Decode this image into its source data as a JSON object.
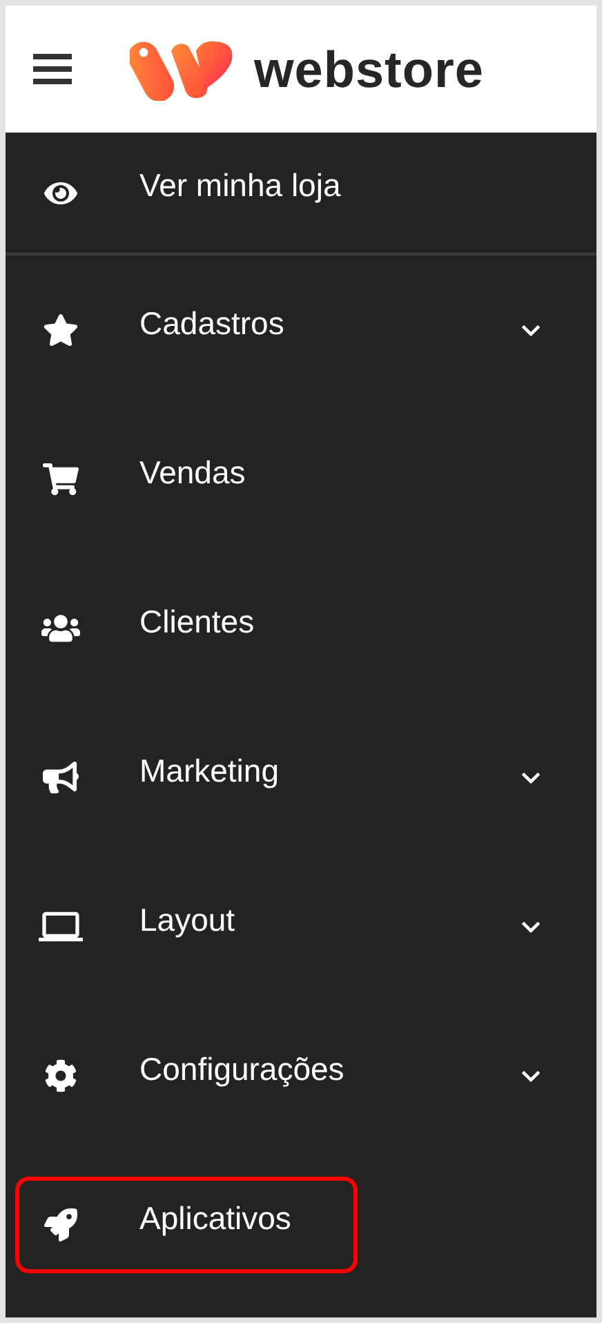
{
  "header": {
    "brand": "webstore"
  },
  "menu": [
    {
      "label": "Ver minha loja",
      "has_submenu": false,
      "highlighted": false,
      "divider_below": true
    },
    {
      "label": "Cadastros",
      "has_submenu": true,
      "highlighted": false,
      "divider_below": false
    },
    {
      "label": "Vendas",
      "has_submenu": false,
      "highlighted": false,
      "divider_below": false
    },
    {
      "label": "Clientes",
      "has_submenu": false,
      "highlighted": false,
      "divider_below": false
    },
    {
      "label": "Marketing",
      "has_submenu": true,
      "highlighted": false,
      "divider_below": false
    },
    {
      "label": "Layout",
      "has_submenu": true,
      "highlighted": false,
      "divider_below": false
    },
    {
      "label": "Configurações",
      "has_submenu": true,
      "highlighted": false,
      "divider_below": false
    },
    {
      "label": "Aplicativos",
      "has_submenu": false,
      "highlighted": true,
      "divider_below": false
    }
  ]
}
